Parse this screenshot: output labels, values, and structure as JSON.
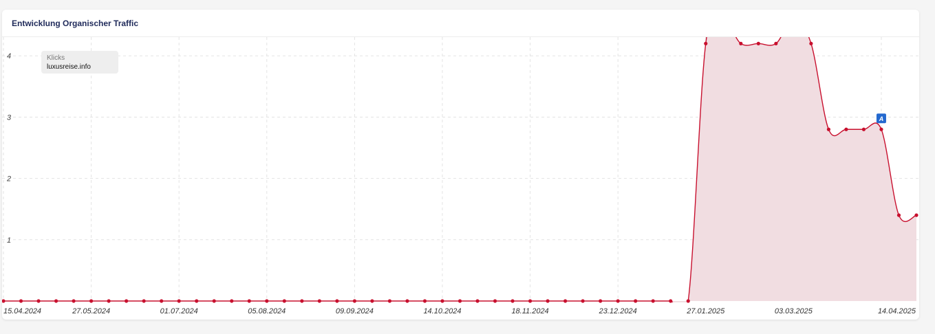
{
  "card": {
    "title": "Entwicklung Organischer Traffic"
  },
  "legend": {
    "series_label": "Klicks",
    "site": "luxusreise.info"
  },
  "colors": {
    "line": "#c8102e",
    "area": "#f1dde1",
    "grid": "#e3e3e3",
    "annotation": "#2469cf"
  },
  "chart_data": {
    "type": "area",
    "title": "Entwicklung Organischer Traffic",
    "xlabel": "",
    "ylabel": "",
    "ylim": [
      0,
      4.4
    ],
    "y_ticks": [
      1,
      2,
      3,
      4
    ],
    "x_tick_labels": [
      "15.04.2024",
      "27.05.2024",
      "01.07.2024",
      "05.08.2024",
      "09.09.2024",
      "14.10.2024",
      "18.11.2024",
      "23.12.2024",
      "27.01.2025",
      "03.03.2025",
      "14.04.2025"
    ],
    "grid": true,
    "legend_position": "top-left",
    "series": [
      {
        "name": "Klicks",
        "x": [
          "15.04.2024",
          "22.04.2024",
          "29.04.2024",
          "06.05.2024",
          "13.05.2024",
          "20.05.2024",
          "27.05.2024",
          "03.06.2024",
          "10.06.2024",
          "17.06.2024",
          "24.06.2024",
          "01.07.2024",
          "08.07.2024",
          "15.07.2024",
          "22.07.2024",
          "29.07.2024",
          "05.08.2024",
          "12.08.2024",
          "19.08.2024",
          "26.08.2024",
          "02.09.2024",
          "09.09.2024",
          "16.09.2024",
          "23.09.2024",
          "30.09.2024",
          "07.10.2024",
          "14.10.2024",
          "21.10.2024",
          "28.10.2024",
          "04.11.2024",
          "11.11.2024",
          "18.11.2024",
          "25.11.2024",
          "02.12.2024",
          "09.12.2024",
          "16.12.2024",
          "23.12.2024",
          "30.12.2024",
          "06.01.2025",
          "13.01.2025",
          "20.01.2025",
          "27.01.2025",
          "03.02.2025",
          "10.02.2025",
          "17.02.2025",
          "24.02.2025",
          "03.03.2025",
          "10.03.2025",
          "17.03.2025",
          "24.03.2025",
          "31.03.2025",
          "07.04.2025",
          "14.04.2025"
        ],
        "values": [
          0,
          0,
          0,
          0,
          0,
          0,
          0,
          0,
          0,
          0,
          0,
          0,
          0,
          0,
          0,
          0,
          0,
          0,
          0,
          0,
          0,
          0,
          0,
          0,
          0,
          0,
          0,
          0,
          0,
          0,
          0,
          0,
          0,
          0,
          0,
          0,
          0,
          0,
          0,
          0,
          4.2,
          4.6,
          4.2,
          4.2,
          4.2,
          4.6,
          4.2,
          2.8,
          2.8,
          2.8,
          2.8,
          1.4,
          1.4
        ]
      }
    ],
    "annotations": [
      {
        "label": "A",
        "x": "31.03.2025"
      }
    ]
  }
}
